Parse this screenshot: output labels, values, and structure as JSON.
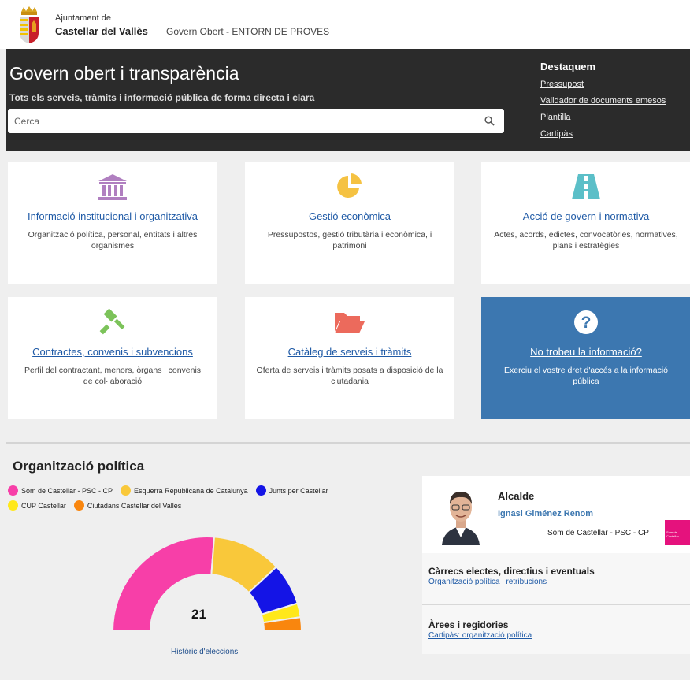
{
  "header": {
    "org_small": "Ajuntament de",
    "org_big": "Castellar del Vallès",
    "portal": "Govern Obert - ENTORN DE PROVES"
  },
  "banner": {
    "title": "Govern obert i transparència",
    "subtitle": "Tots els serveis, tràmits i informació pública de forma directa i clara",
    "search_placeholder": "Cerca",
    "featured_title": "Destaquem",
    "featured_links": [
      "Pressupost",
      "Validador de documents emesos",
      "Plantilla",
      "Cartipàs"
    ]
  },
  "cards": [
    {
      "title": "Informació institucional i organitzativa",
      "desc": "Organització política, personal, entitats i altres organismes",
      "icon": "building-icon",
      "color": "#b07fc0"
    },
    {
      "title": "Gestió econòmica",
      "desc": "Pressupostos, gestió tributària i econòmica, i patrimoni",
      "icon": "pie-chart-icon",
      "color": "#f5c242"
    },
    {
      "title": "Acció de govern i normativa",
      "desc": "Actes, acords, edictes, convocatòries, normatives, plans i estratègies",
      "icon": "road-icon",
      "color": "#5bbfc8"
    },
    {
      "title": "Contractes, convenis i subvencions",
      "desc": "Perfil del contractant, menors, òrgans i convenis de col·laboració",
      "icon": "gavel-icon",
      "color": "#7cc35a"
    },
    {
      "title": "Catàleg de serveis i tràmits",
      "desc": "Oferta de serveis i tràmits posats a disposició de la ciutadania",
      "icon": "folder-icon",
      "color": "#ec6a5c"
    },
    {
      "title": "No trobeu la informació?",
      "desc": "Exerciu el vostre dret d'accés a la informació pública",
      "icon": "question-icon",
      "color": "#3c77b0"
    }
  ],
  "politics": {
    "title": "Organització política",
    "legend": [
      {
        "name": "Som de Castellar - PSC - CP",
        "color": "#f73fa8"
      },
      {
        "name": "Esquerra Republicana de Catalunya",
        "color": "#f9c83a"
      },
      {
        "name": "Junts per Castellar",
        "color": "#1414e6"
      },
      {
        "name": "CUP Castellar",
        "color": "#ffe81a"
      },
      {
        "name": "Ciutadans Castellar del Vallès",
        "color": "#f9860e"
      }
    ],
    "total_seats": "21",
    "history_link": "Històric d'eleccions"
  },
  "chart_data": {
    "type": "pie",
    "categories": [
      "Som de Castellar - PSC - CP",
      "Esquerra Republicana de Catalunya",
      "Junts per Castellar",
      "CUP Castellar",
      "Ciutadans Castellar del Vallès"
    ],
    "values": [
      11,
      5,
      3,
      1,
      1
    ],
    "colors": [
      "#f73fa8",
      "#f9c83a",
      "#1414e6",
      "#ffe81a",
      "#f9860e"
    ]
  },
  "mayor": {
    "role": "Alcalde",
    "name": "Ignasi Giménez Renom",
    "party": "Som de Castellar - PSC - CP",
    "party_logo_text": "Som de Castellar"
  },
  "sections": [
    {
      "title": "Càrrecs electes, directius i eventuals",
      "link": "Organització política i retribucions"
    },
    {
      "title": "Àrees i regidories",
      "link": "Cartipàs: organització política"
    }
  ]
}
